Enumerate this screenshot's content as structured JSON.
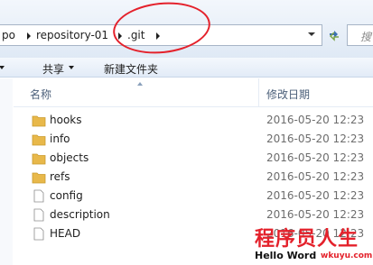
{
  "address": {
    "crumbs": [
      "po",
      "repository-01",
      ".git"
    ],
    "search_placeholder": "搜"
  },
  "toolbar": {
    "share_label": "共享",
    "new_folder_label": "新建文件夹"
  },
  "columns": {
    "name": "名称",
    "date": "修改日期"
  },
  "files": [
    {
      "name": "hooks",
      "date": "2016-05-20 12:23",
      "type": "folder"
    },
    {
      "name": "info",
      "date": "2016-05-20 12:23",
      "type": "folder"
    },
    {
      "name": "objects",
      "date": "2016-05-20 12:23",
      "type": "folder"
    },
    {
      "name": "refs",
      "date": "2016-05-20 12:23",
      "type": "folder"
    },
    {
      "name": "config",
      "date": "2016-05-20 12:23",
      "type": "file"
    },
    {
      "name": "description",
      "date": "2016-05-20 12:23",
      "type": "file"
    },
    {
      "name": "HEAD",
      "date": "2016-05-20 12:23",
      "type": "file"
    }
  ],
  "watermark": {
    "cn": "程序员人生",
    "en": "Hello Word",
    "url": "wkuyu.com"
  },
  "colors": {
    "annotation": "#e4212b",
    "folder": "#e8b84a"
  }
}
